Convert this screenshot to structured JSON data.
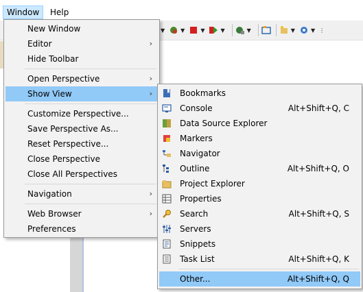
{
  "menubar": {
    "items": [
      {
        "label": "Window"
      },
      {
        "label": "Help"
      }
    ]
  },
  "colors": {
    "menu_bg": "#f2f2f2",
    "highlight": "#91c9f7",
    "menubar_active": "#cce8ff"
  },
  "window_menu": {
    "items": [
      {
        "label": "New Window"
      },
      {
        "label": "Editor",
        "submenu": true
      },
      {
        "label": "Hide Toolbar"
      },
      {
        "label": "Open Perspective",
        "submenu": true
      },
      {
        "label": "Show View",
        "submenu": true
      },
      {
        "label": "Customize Perspective..."
      },
      {
        "label": "Save Perspective As..."
      },
      {
        "label": "Reset Perspective..."
      },
      {
        "label": "Close Perspective"
      },
      {
        "label": "Close All Perspectives"
      },
      {
        "label": "Navigation",
        "submenu": true
      },
      {
        "label": "Web Browser",
        "submenu": true
      },
      {
        "label": "Preferences"
      }
    ],
    "arrow": "›"
  },
  "show_view_menu": {
    "items": [
      {
        "label": "Bookmarks",
        "shortcut": "",
        "icon": "bookmarks-icon"
      },
      {
        "label": "Console",
        "shortcut": "Alt+Shift+Q, C",
        "icon": "console-icon"
      },
      {
        "label": "Data Source Explorer",
        "shortcut": "",
        "icon": "data-source-icon"
      },
      {
        "label": "Markers",
        "shortcut": "",
        "icon": "markers-icon"
      },
      {
        "label": "Navigator",
        "shortcut": "",
        "icon": "navigator-icon"
      },
      {
        "label": "Outline",
        "shortcut": "Alt+Shift+Q, O",
        "icon": "outline-icon"
      },
      {
        "label": "Project Explorer",
        "shortcut": "",
        "icon": "project-explorer-icon"
      },
      {
        "label": "Properties",
        "shortcut": "",
        "icon": "properties-icon"
      },
      {
        "label": "Search",
        "shortcut": "Alt+Shift+Q, S",
        "icon": "search-icon"
      },
      {
        "label": "Servers",
        "shortcut": "",
        "icon": "servers-icon"
      },
      {
        "label": "Snippets",
        "shortcut": "",
        "icon": "snippets-icon"
      },
      {
        "label": "Task List",
        "shortcut": "Alt+Shift+Q, K",
        "icon": "task-list-icon"
      },
      {
        "label": "Other...",
        "shortcut": "Alt+Shift+Q, Q",
        "icon": ""
      }
    ]
  },
  "toolbar": {
    "icons": [
      "bug-run-icon",
      "stop-icon",
      "run-icon",
      "external-tools-icon",
      "new-server-icon",
      "new-project-icon",
      "settings-gear-icon"
    ]
  }
}
